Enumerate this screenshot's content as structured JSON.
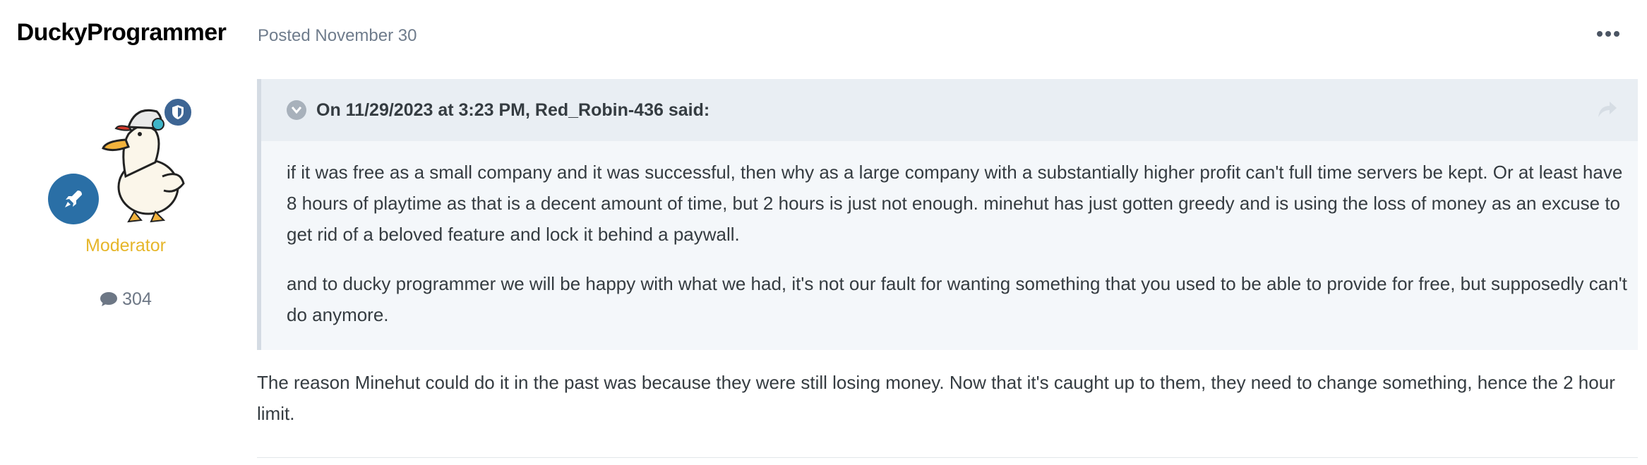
{
  "author": {
    "username": "DuckyProgrammer",
    "role": "Moderator",
    "post_count": "304",
    "avatar_icon": "duck-avatar",
    "group_icon": "rocket-icon",
    "badge_icon": "shield-icon"
  },
  "post": {
    "meta": "Posted November 30",
    "more_icon": "more-dots-icon",
    "quote": {
      "citation": "On 11/29/2023 at 3:23 PM, Red_Robin-436 said:",
      "paragraphs": [
        "if it was free as a small company and it was successful, then why as a large company with a substantially higher profit can't full time servers be kept. Or at least have 8 hours of playtime as that is a decent amount of time, but 2 hours is just not enough. minehut has just gotten greedy and is using the loss of money as an excuse to get rid of a beloved feature and lock it behind a paywall.",
        "and to ducky programmer we will be happy with what we had, it's not our fault for wanting something that you used to be able to provide for free, but supposedly can't do anymore."
      ]
    },
    "reply": "The reason Minehut could do it in the past was because they were still losing money. Now that it's caught up to them, they need to change something, hence the 2 hour limit."
  },
  "colors": {
    "role": "#e6b62a",
    "group_icon_bg": "#2a6fa6",
    "badge_bg": "#3d6594",
    "quote_bg": "#f4f7fa",
    "quote_head_bg": "#e9eef3"
  }
}
